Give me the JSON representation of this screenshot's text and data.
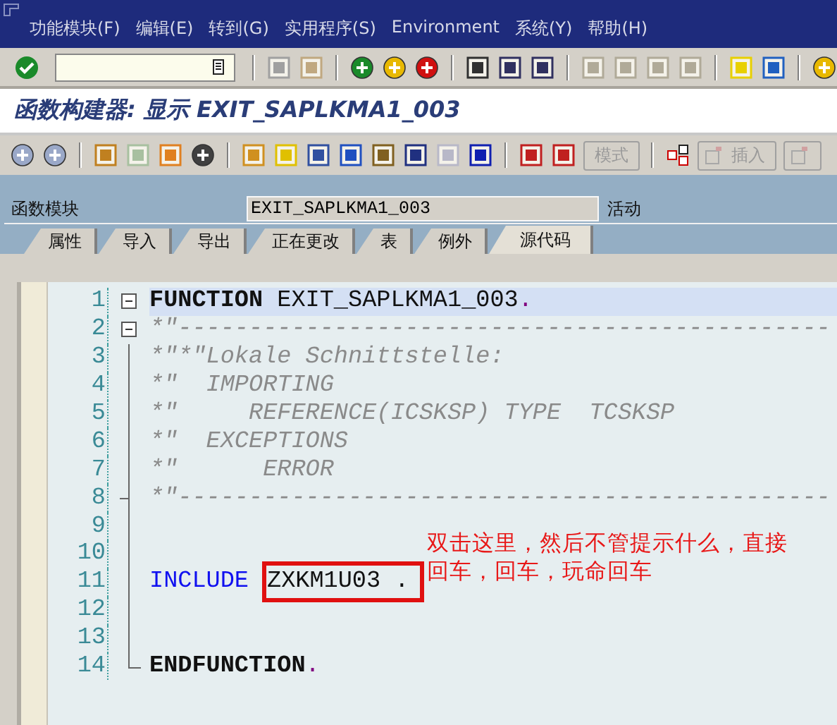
{
  "menu_bar": {
    "items": [
      "功能模块(F)",
      "编辑(E)",
      "转到(G)",
      "实用程序(S)",
      "Environment",
      "系统(Y)",
      "帮助(H)"
    ]
  },
  "title": "函数构建器: 显示 EXIT_SAPLKMA1_003",
  "app_toolbar": {
    "buttons": [
      {
        "label": "模式",
        "disabled": true
      },
      {
        "label": "插入",
        "disabled": true
      }
    ]
  },
  "header": {
    "label": "函数模块",
    "value": "EXIT_SAPLKMA1_003",
    "status": "活动"
  },
  "tabs": [
    {
      "label": "属性",
      "selected": false
    },
    {
      "label": "导入",
      "selected": false
    },
    {
      "label": "导出",
      "selected": false
    },
    {
      "label": "正在更改",
      "selected": false
    },
    {
      "label": "表",
      "selected": false
    },
    {
      "label": "例外",
      "selected": false
    },
    {
      "label": "源代码",
      "selected": true
    }
  ],
  "editor": {
    "lines": [
      {
        "number": "1",
        "kind": "fold_start",
        "current": true,
        "segments": [
          {
            "kind": "keyword",
            "text": "FUNCTION"
          },
          {
            "kind": "plain",
            "text": " EXIT_SAPLKMA1_003"
          },
          {
            "kind": "period",
            "text": "."
          }
        ]
      },
      {
        "number": "2",
        "kind": "fold_start",
        "current": false,
        "segments": [
          {
            "kind": "comment",
            "text": "*\"----------------------------------------------"
          }
        ]
      },
      {
        "number": "3",
        "kind": "fold_body",
        "current": false,
        "segments": [
          {
            "kind": "comment",
            "text": "*\"*\"Lokale Schnittstelle:"
          }
        ]
      },
      {
        "number": "4",
        "kind": "fold_body",
        "current": false,
        "segments": [
          {
            "kind": "comment",
            "text": "*\"  IMPORTING"
          }
        ]
      },
      {
        "number": "5",
        "kind": "fold_body",
        "current": false,
        "segments": [
          {
            "kind": "comment",
            "text": "*\"     REFERENCE(ICSKSP) TYPE  TCSKSP"
          }
        ]
      },
      {
        "number": "6",
        "kind": "fold_body",
        "current": false,
        "segments": [
          {
            "kind": "comment",
            "text": "*\"  EXCEPTIONS"
          }
        ]
      },
      {
        "number": "7",
        "kind": "fold_body",
        "current": false,
        "segments": [
          {
            "kind": "comment",
            "text": "*\"      ERROR"
          }
        ]
      },
      {
        "number": "8",
        "kind": "fold_end",
        "current": false,
        "segments": [
          {
            "kind": "comment",
            "text": "*\"----------------------------------------------"
          }
        ]
      },
      {
        "number": "9",
        "kind": "fold_body",
        "current": false
      },
      {
        "number": "10",
        "kind": "fold_body",
        "current": false
      },
      {
        "number": "11",
        "kind": "fold_body",
        "current": false,
        "segments": [
          {
            "kind": "include",
            "text": "INCLUDE"
          },
          {
            "kind": "marked",
            "text": "ZXKM1U03 ."
          }
        ]
      },
      {
        "number": "12",
        "kind": "fold_body",
        "current": false
      },
      {
        "number": "13",
        "kind": "fold_body",
        "current": false
      },
      {
        "number": "14",
        "kind": "fold_close",
        "current": false,
        "segments": [
          {
            "kind": "keyword",
            "text": "ENDFUNCTION"
          },
          {
            "kind": "period",
            "text": "."
          }
        ]
      }
    ]
  },
  "annotation": {
    "lines": [
      "双击这里，然后不管提示什么，直接",
      "回车，回车，玩命回车"
    ]
  }
}
